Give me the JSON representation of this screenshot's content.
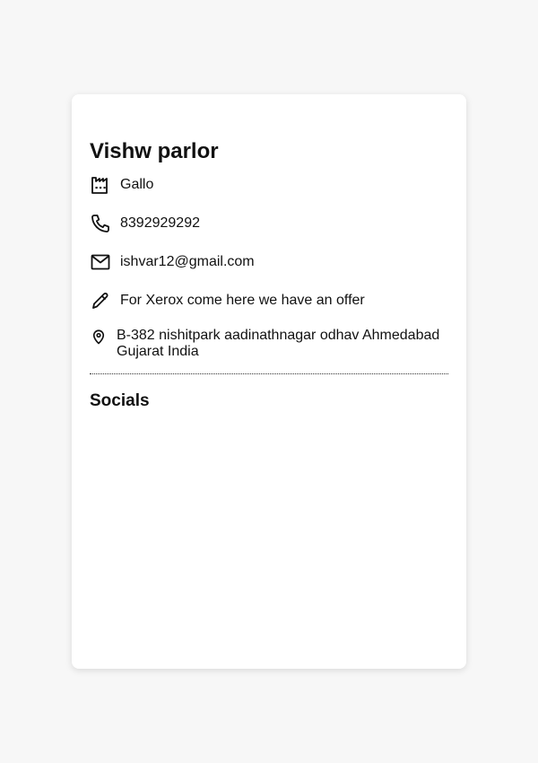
{
  "card": {
    "title": "Vishw parlor",
    "company": {
      "icon": "factory-icon",
      "text": "Gallo"
    },
    "phone": {
      "icon": "phone-icon",
      "text": "8392929292"
    },
    "email": {
      "icon": "mail-icon",
      "text": "ishvar12@gmail.com"
    },
    "note": {
      "icon": "pencil-icon",
      "text": "For Xerox come here we have an offer"
    },
    "address": {
      "icon": "map-pin-icon",
      "text": "B-382 nishitpark aadinathnagar odhav Ahmedabad Gujarat India"
    },
    "socials_heading": "Socials"
  },
  "colors": {
    "page_background": "#f7f7f7",
    "card_background": "#ffffff",
    "text": "#111111"
  }
}
